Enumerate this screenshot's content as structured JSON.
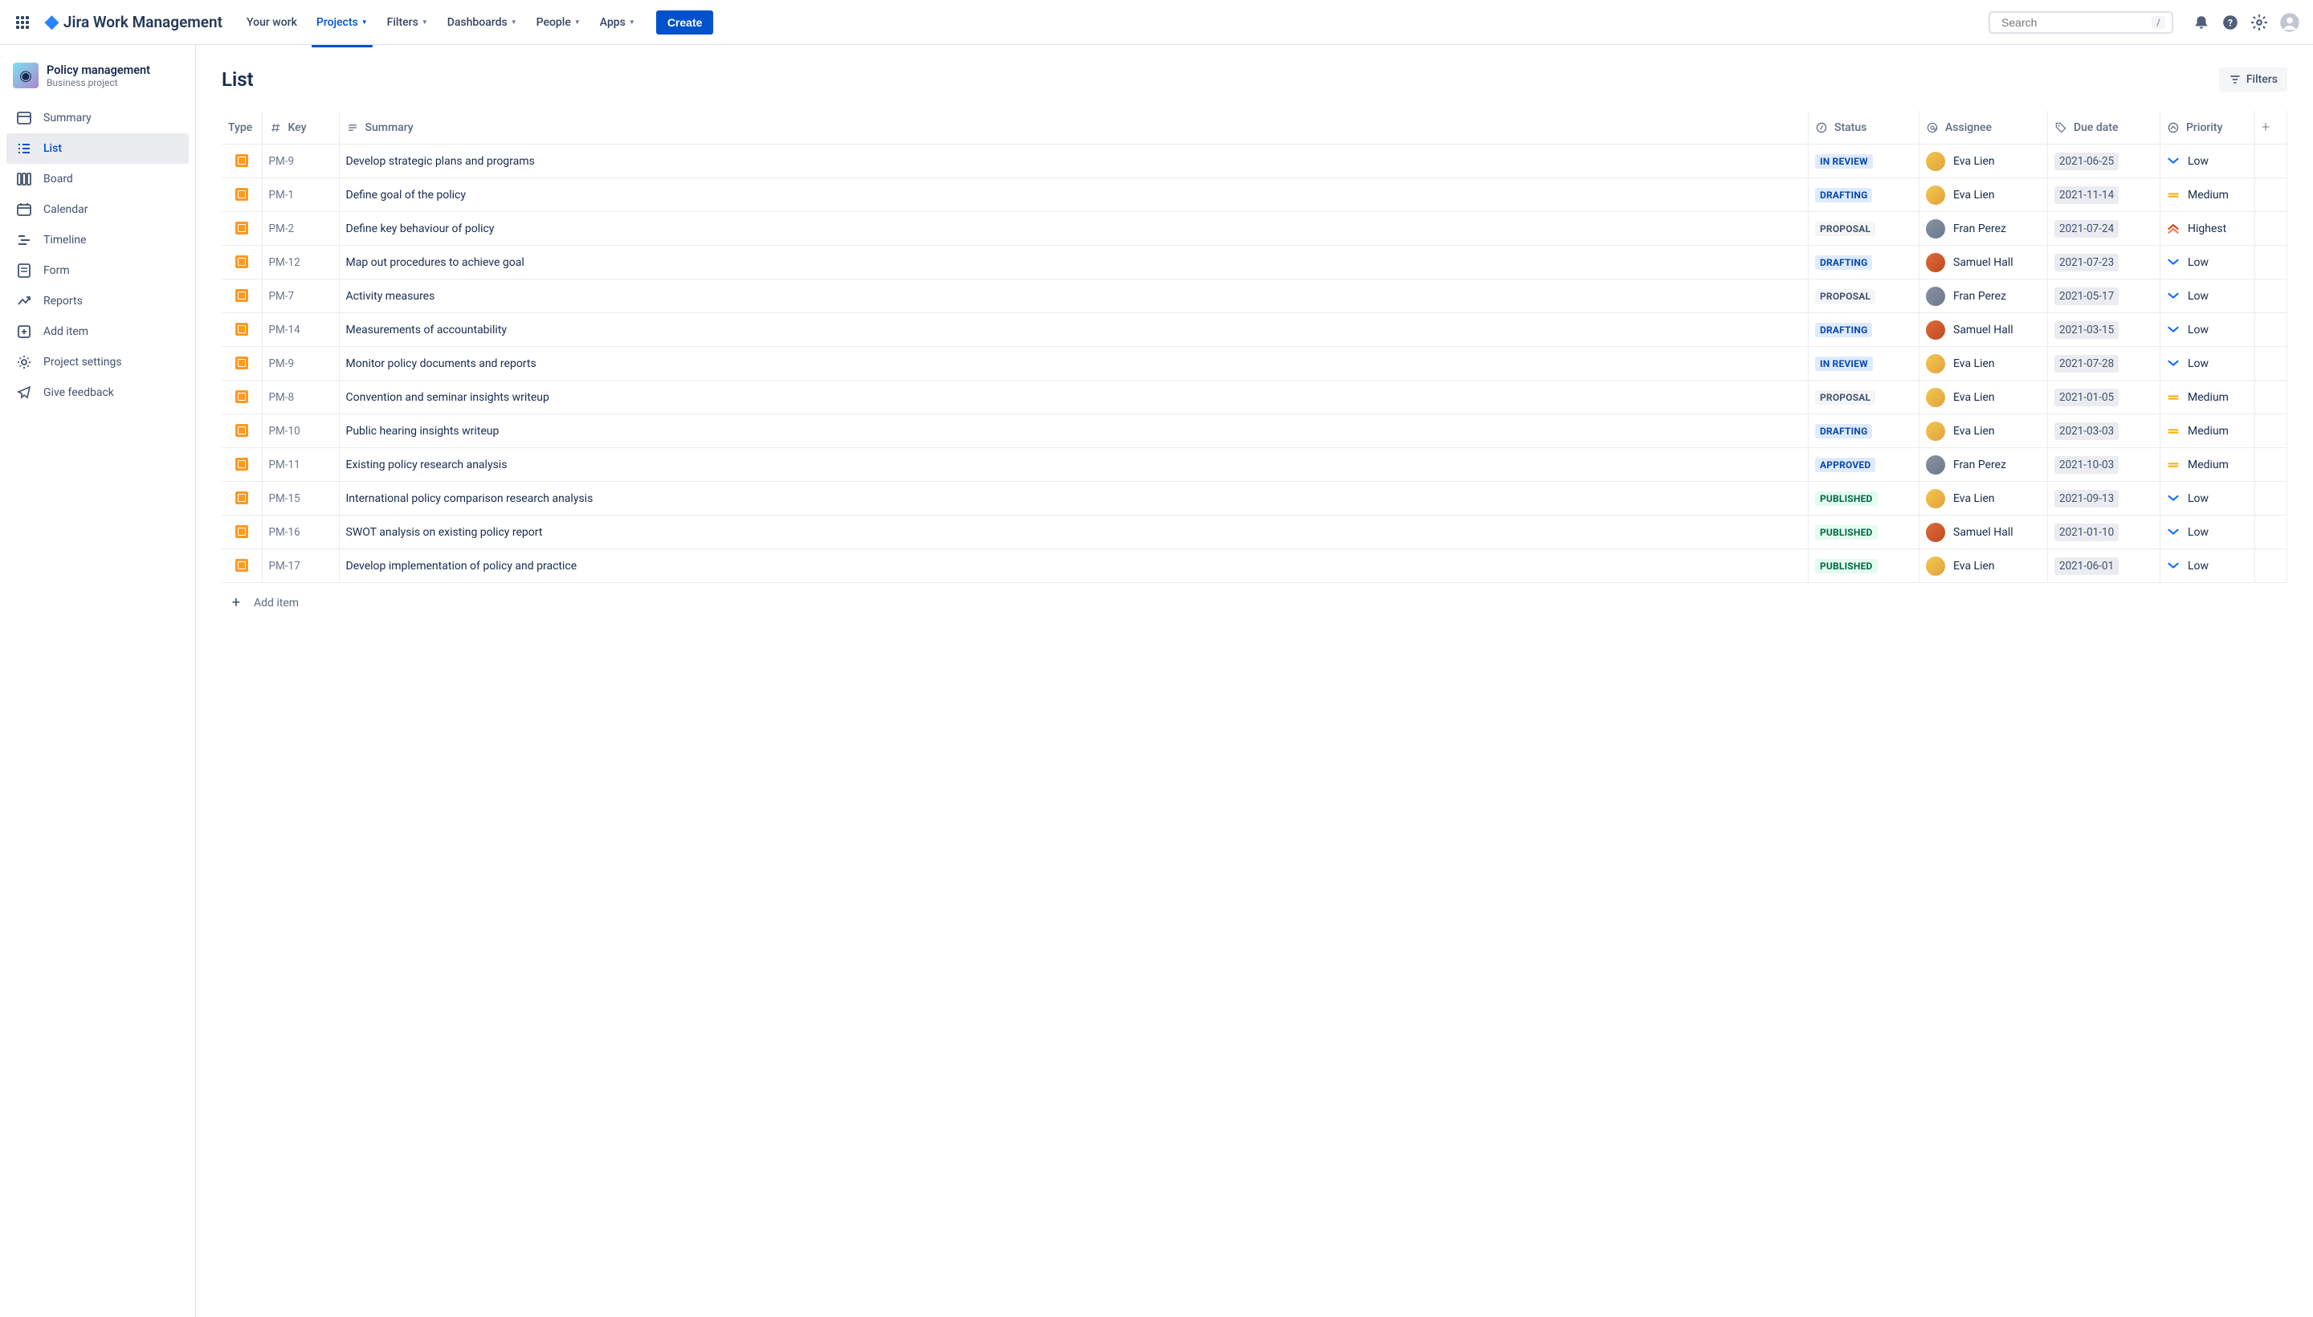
{
  "topnav": {
    "logo_text": "Jira Work Management",
    "items": [
      {
        "label": "Your work",
        "dropdown": false
      },
      {
        "label": "Projects",
        "dropdown": true,
        "active": true
      },
      {
        "label": "Filters",
        "dropdown": true
      },
      {
        "label": "Dashboards",
        "dropdown": true
      },
      {
        "label": "People",
        "dropdown": true
      },
      {
        "label": "Apps",
        "dropdown": true
      }
    ],
    "create_label": "Create",
    "search_placeholder": "Search",
    "search_kbd": "/"
  },
  "sidebar": {
    "project_name": "Policy management",
    "project_type": "Business project",
    "items": [
      {
        "label": "Summary",
        "icon": "summary"
      },
      {
        "label": "List",
        "icon": "list",
        "active": true
      },
      {
        "label": "Board",
        "icon": "board"
      },
      {
        "label": "Calendar",
        "icon": "calendar"
      },
      {
        "label": "Timeline",
        "icon": "timeline"
      },
      {
        "label": "Form",
        "icon": "form"
      },
      {
        "label": "Reports",
        "icon": "reports"
      },
      {
        "label": "Add item",
        "icon": "add"
      },
      {
        "label": "Project settings",
        "icon": "settings"
      },
      {
        "label": "Give feedback",
        "icon": "feedback"
      }
    ]
  },
  "main": {
    "title": "List",
    "filters_label": "Filters",
    "add_item_label": "Add item",
    "columns": {
      "type": "Type",
      "key": "Key",
      "summary": "Summary",
      "status": "Status",
      "assignee": "Assignee",
      "due_date": "Due date",
      "priority": "Priority"
    },
    "rows": [
      {
        "key": "PM-9",
        "summary": "Develop strategic plans and programs",
        "status": "IN REVIEW",
        "status_class": "inreview",
        "assignee": "Eva Lien",
        "avatar": "eva",
        "due": "2021-06-25",
        "priority": "Low",
        "prio_icon": "low"
      },
      {
        "key": "PM-1",
        "summary": "Define goal of the policy",
        "status": "DRAFTING",
        "status_class": "drafting",
        "assignee": "Eva Lien",
        "avatar": "eva",
        "due": "2021-11-14",
        "priority": "Medium",
        "prio_icon": "medium"
      },
      {
        "key": "PM-2",
        "summary": "Define key behaviour of policy",
        "status": "PROPOSAL",
        "status_class": "proposal",
        "assignee": "Fran Perez",
        "avatar": "fran",
        "due": "2021-07-24",
        "priority": "Highest",
        "prio_icon": "highest"
      },
      {
        "key": "PM-12",
        "summary": "Map out procedures to achieve goal",
        "status": "DRAFTING",
        "status_class": "drafting",
        "assignee": "Samuel Hall",
        "avatar": "samuel",
        "due": "2021-07-23",
        "priority": "Low",
        "prio_icon": "low"
      },
      {
        "key": "PM-7",
        "summary": "Activity measures",
        "status": "PROPOSAL",
        "status_class": "proposal",
        "assignee": "Fran Perez",
        "avatar": "fran",
        "due": "2021-05-17",
        "priority": "Low",
        "prio_icon": "low"
      },
      {
        "key": "PM-14",
        "summary": "Measurements of accountability",
        "status": "DRAFTING",
        "status_class": "drafting",
        "assignee": "Samuel Hall",
        "avatar": "samuel",
        "due": "2021-03-15",
        "priority": "Low",
        "prio_icon": "low"
      },
      {
        "key": "PM-9",
        "summary": "Monitor policy documents and reports",
        "status": "IN REVIEW",
        "status_class": "inreview",
        "assignee": "Eva Lien",
        "avatar": "eva",
        "due": "2021-07-28",
        "priority": "Low",
        "prio_icon": "low"
      },
      {
        "key": "PM-8",
        "summary": "Convention and seminar insights writeup",
        "status": "PROPOSAL",
        "status_class": "proposal",
        "assignee": "Eva Lien",
        "avatar": "eva",
        "due": "2021-01-05",
        "priority": "Medium",
        "prio_icon": "medium"
      },
      {
        "key": "PM-10",
        "summary": "Public hearing insights writeup",
        "status": "DRAFTING",
        "status_class": "drafting",
        "assignee": "Eva Lien",
        "avatar": "eva",
        "due": "2021-03-03",
        "priority": "Medium",
        "prio_icon": "medium"
      },
      {
        "key": "PM-11",
        "summary": "Existing policy research analysis",
        "status": "APPROVED",
        "status_class": "approved",
        "assignee": "Fran Perez",
        "avatar": "fran",
        "due": "2021-10-03",
        "priority": "Medium",
        "prio_icon": "medium"
      },
      {
        "key": "PM-15",
        "summary": "International policy comparison research analysis",
        "status": "PUBLISHED",
        "status_class": "published",
        "assignee": "Eva Lien",
        "avatar": "eva",
        "due": "2021-09-13",
        "priority": "Low",
        "prio_icon": "low"
      },
      {
        "key": "PM-16",
        "summary": "SWOT analysis on existing policy report",
        "status": "PUBLISHED",
        "status_class": "published",
        "assignee": "Samuel Hall",
        "avatar": "samuel",
        "due": "2021-01-10",
        "priority": "Low",
        "prio_icon": "low"
      },
      {
        "key": "PM-17",
        "summary": "Develop implementation of policy and practice",
        "status": "PUBLISHED",
        "status_class": "published",
        "assignee": "Eva Lien",
        "avatar": "eva",
        "due": "2021-06-01",
        "priority": "Low",
        "prio_icon": "low"
      }
    ]
  }
}
